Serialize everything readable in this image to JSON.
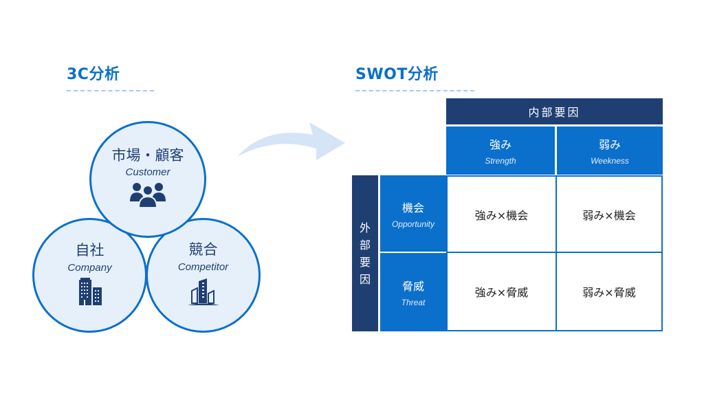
{
  "left": {
    "title": "3C分析",
    "circles": [
      {
        "jp": "市場・顧客",
        "en": "Customer",
        "icon": "people-icon"
      },
      {
        "jp": "自社",
        "en": "Company",
        "icon": "office-buildings-icon"
      },
      {
        "jp": "競合",
        "en": "Competitor",
        "icon": "skyscraper-buildings-icon"
      }
    ]
  },
  "arrow": {
    "icon": "curved-arrow-right-icon"
  },
  "right": {
    "title": "SWOT分析",
    "internal_header": "内部要因",
    "external_header": "外部要因",
    "columns": [
      {
        "jp": "強み",
        "en": "Strength"
      },
      {
        "jp": "弱み",
        "en": "Weekness"
      }
    ],
    "rows": [
      {
        "jp": "機会",
        "en": "Opportunity"
      },
      {
        "jp": "脅威",
        "en": "Threat"
      }
    ],
    "cells": [
      [
        "強み×機会",
        "弱み×機会"
      ],
      [
        "強み×脅威",
        "弱み×脅威"
      ]
    ]
  },
  "colors": {
    "accent": "#0b6fcc",
    "navy": "#1f3f73",
    "circle_fill": "#e6f0fa",
    "arrow": "#d5e4f7"
  }
}
